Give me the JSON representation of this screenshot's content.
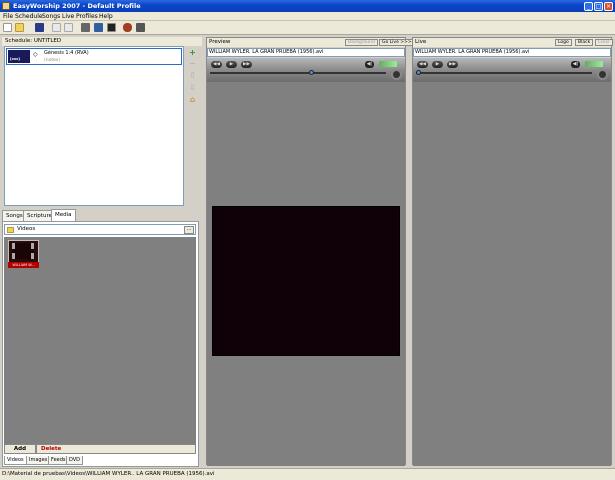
{
  "window": {
    "title": "EasyWorship 2007 - Default Profile",
    "minimize": "_",
    "maximize": "□",
    "close": "×"
  },
  "menu": [
    "File",
    "Schedule",
    "Songs",
    "Live",
    "Profiles",
    "Help"
  ],
  "toolbar_icons": [
    "new-icon",
    "open-icon",
    "save-icon",
    "cut-icon",
    "copy-icon",
    "print-icon",
    "settings-icon",
    "monitor-icon",
    "user-icon",
    "sound-icon"
  ],
  "schedule": {
    "header": "Schedule: UNTITLED",
    "items": [
      {
        "thumb_label": "[xxx]",
        "title": "Génesis 1:4 (RVA)",
        "subtitle": "(notes)"
      }
    ],
    "side_buttons": [
      "+",
      "−",
      "⇧",
      "⇩",
      "⌂"
    ]
  },
  "library": {
    "tabs": [
      "Songs",
      "Scriptures",
      "Media"
    ],
    "active_tab": "Media",
    "folder": "Videos",
    "folder_button": "...",
    "items": [
      {
        "label": "WILLIAM W..."
      }
    ],
    "add_label": "Add",
    "delete_label": "Delete",
    "bottom_tabs": [
      "Videos",
      "Images",
      "Feeds",
      "DVD"
    ]
  },
  "preview": {
    "title": "Preview",
    "background_button": "Background",
    "golive_button": "Go Live >>>",
    "file": "WILLIAM WYLER. LA GRAN PRUEBA (1956).avi"
  },
  "live": {
    "title": "Live",
    "logo_button": "Logo",
    "black_button": "Black",
    "clear_button": "Clear",
    "file": "WILLIAM WYLER. LA GRAN PRUEBA (1956).avi"
  },
  "transport": {
    "rewind": "◀◀",
    "play": "▶",
    "forward": "▶▶",
    "speaker": "◀)"
  },
  "status": {
    "path": "D:\\Material de pruebas\\Videos\\WILLIAM WYLER.. LA GRAN PRUEBA (1956).avi"
  },
  "colors": {
    "titlebar": "#0b46c9",
    "stage": "#808080",
    "video": "#100008",
    "delete": "#b00000"
  }
}
